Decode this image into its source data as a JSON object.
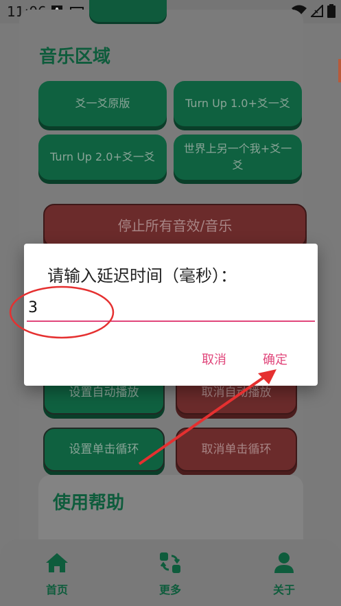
{
  "status_bar": {
    "time": "11:06",
    "a_icon_letter": "A"
  },
  "music_section": {
    "title": "音乐区域",
    "buttons": [
      "爻一爻原版",
      "Turn Up 1.0+爻一爻",
      "Turn Up 2.0+爻一爻",
      "世界上另一个我+爻一爻"
    ],
    "stop_all": "停止所有音效/音乐"
  },
  "playback": {
    "set_auto": "设置自动播放",
    "cancel_auto": "取消自动播放",
    "set_loop": "设置单击循环",
    "cancel_loop": "取消单击循环"
  },
  "help": {
    "title": "使用帮助"
  },
  "dialog": {
    "title": "请输入延迟时间（毫秒）：",
    "input_value": "3",
    "cancel": "取消",
    "confirm": "确定"
  },
  "nav": {
    "home": "首页",
    "more": "更多",
    "about": "关于"
  },
  "colors": {
    "accent_pink": "#e0457a",
    "green": "#0f6140",
    "red": "#6b2b2b",
    "annotation_red": "#e53030"
  }
}
